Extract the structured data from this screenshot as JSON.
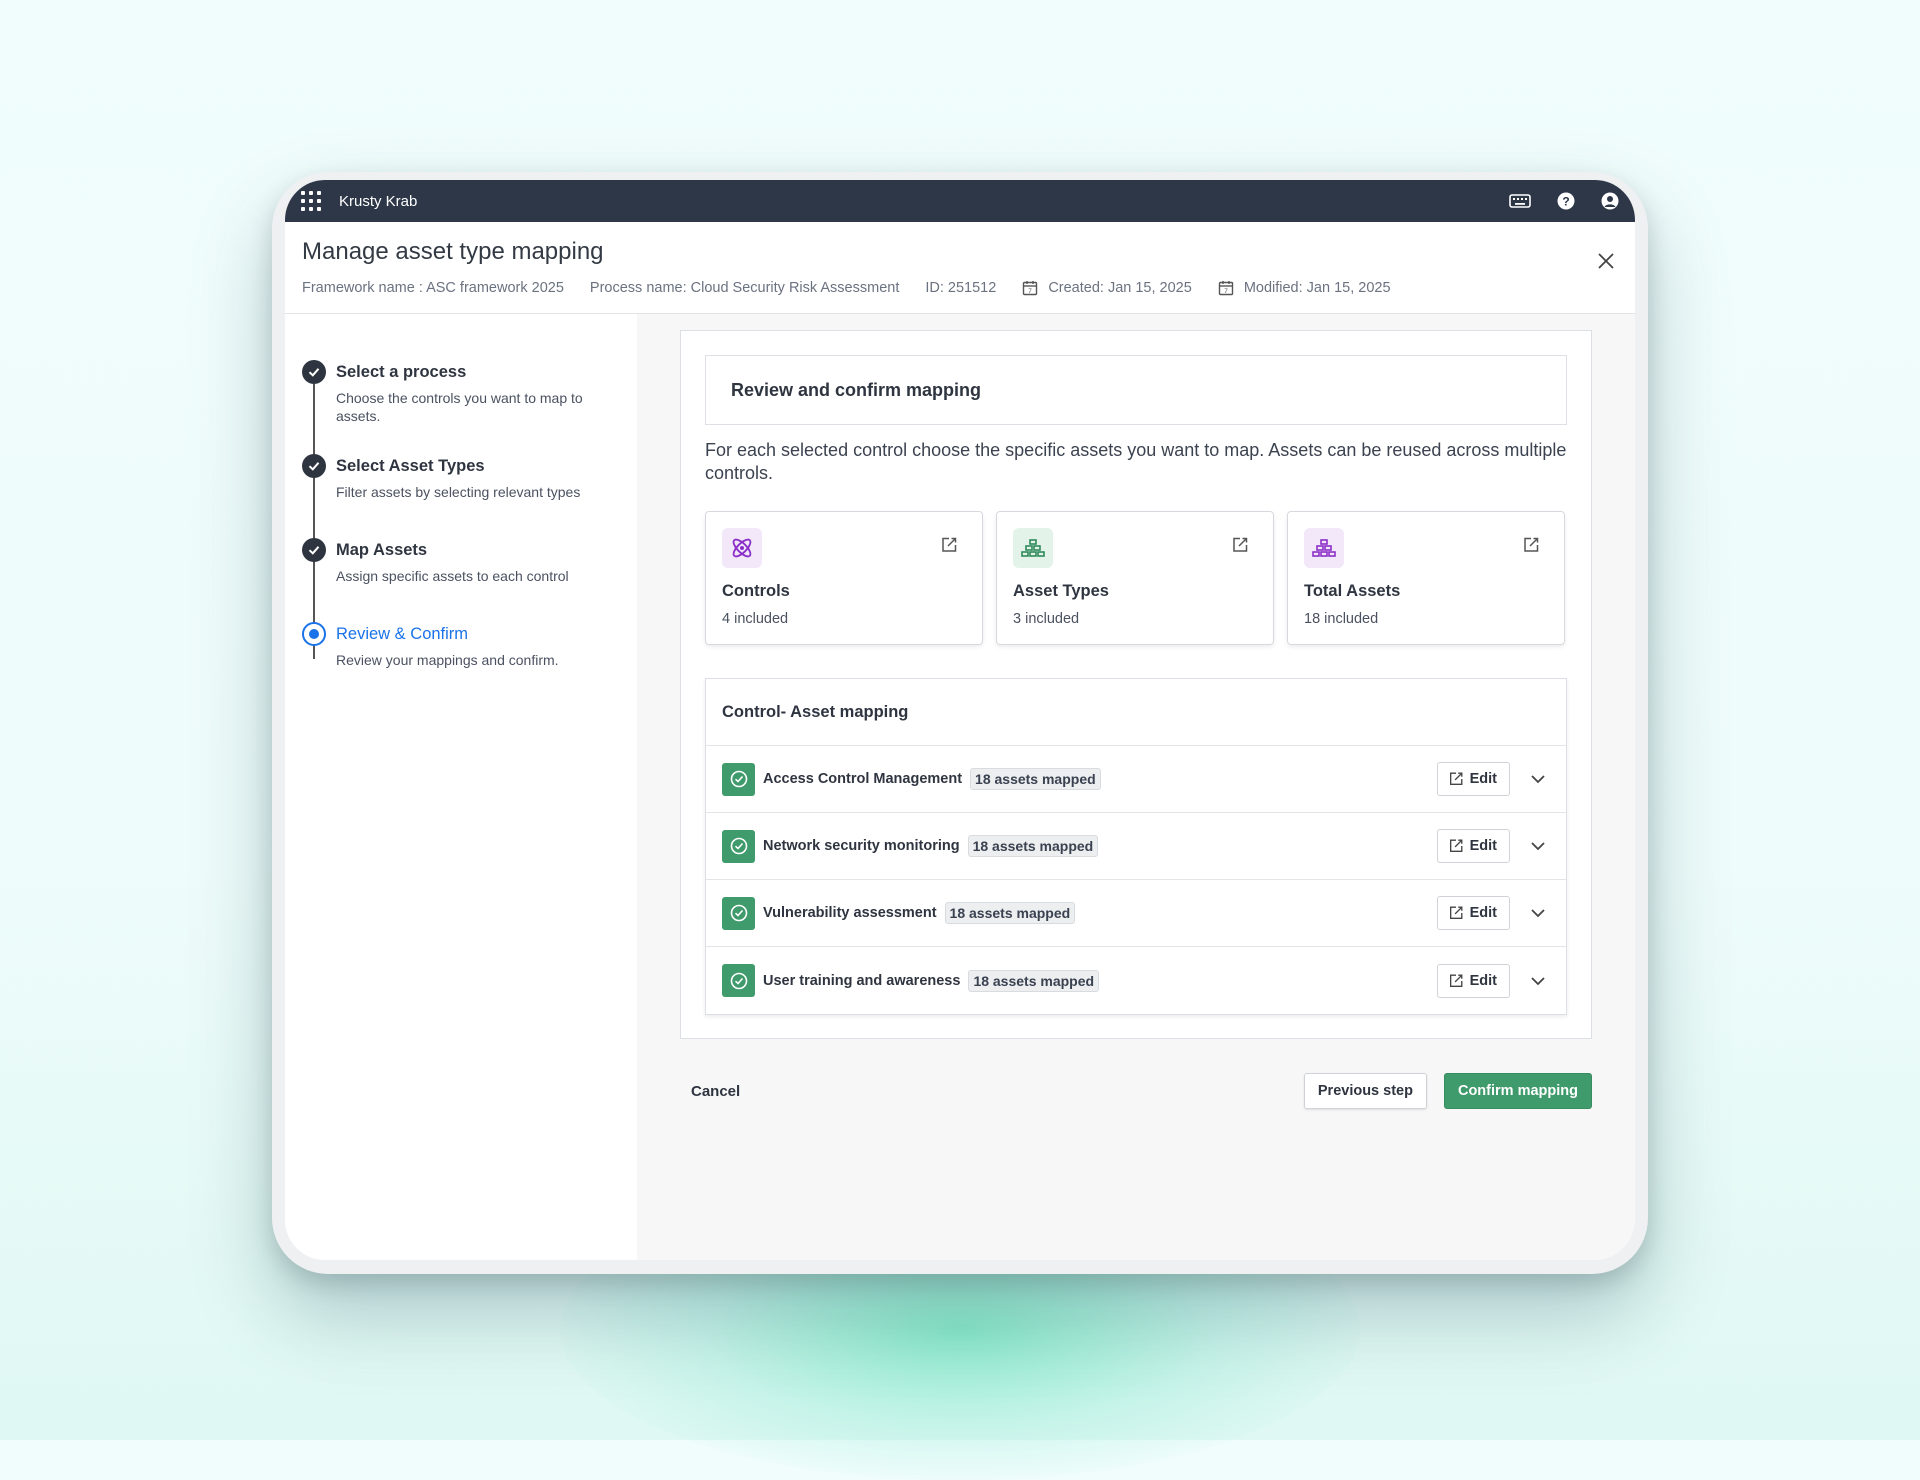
{
  "topbar": {
    "brand": "Krusty Krab"
  },
  "header": {
    "title": "Manage asset type mapping",
    "framework": "Framework name : ASC framework 2025",
    "process": "Process name: Cloud Security Risk Assessment",
    "id": "ID: 251512",
    "created": "Created: Jan 15, 2025",
    "modified": "Modified: Jan 15, 2025"
  },
  "steps": [
    {
      "title": "Select a process",
      "desc": "Choose the controls you want to map to assets.",
      "status": "done"
    },
    {
      "title": "Select Asset Types",
      "desc": "Filter assets by selecting relevant types",
      "status": "done"
    },
    {
      "title": "Map Assets",
      "desc": "Assign specific assets to each control",
      "status": "done"
    },
    {
      "title": "Review & Confirm",
      "desc": "Review your mappings and confirm.",
      "status": "active"
    }
  ],
  "review": {
    "heading": "Review and confirm mapping",
    "description": "For each selected control choose the specific assets you want to map. Assets can be reused across multiple controls."
  },
  "cards": [
    {
      "name": "Controls",
      "count": "4 included",
      "icon": "atom-icon",
      "color": "#8b2fc9",
      "bg": "#f2e8fa"
    },
    {
      "name": "Asset Types",
      "count": "3 included",
      "icon": "stack-icon",
      "color": "#2f8a5a",
      "bg": "#e3f3ea"
    },
    {
      "name": "Total Assets",
      "count": "18 included",
      "icon": "stack-icon",
      "color": "#8b2fc9",
      "bg": "#f2e8fa"
    }
  ],
  "mapping": {
    "heading": "Control- Asset mapping",
    "edit_label": "Edit",
    "rows": [
      {
        "label": "Access Control Management",
        "badge": "18 assets mapped"
      },
      {
        "label": "Network security monitoring",
        "badge": "18 assets mapped"
      },
      {
        "label": "Vulnerability assessment",
        "badge": "18 assets mapped"
      },
      {
        "label": "User training and awareness",
        "badge": "18 assets mapped"
      }
    ]
  },
  "footer": {
    "cancel": "Cancel",
    "previous": "Previous step",
    "confirm": "Confirm mapping"
  },
  "colors": {
    "accent": "#3f9a6c",
    "active_step": "#1a73e8",
    "topbar": "#2d3748"
  }
}
